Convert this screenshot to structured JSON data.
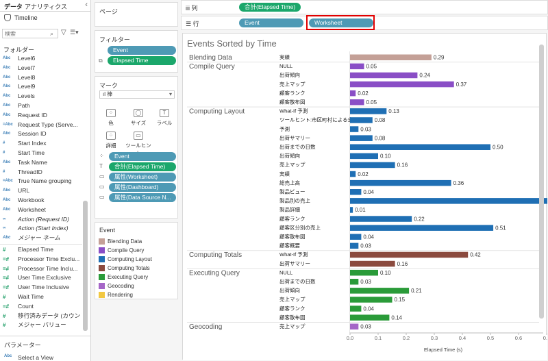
{
  "datapane": {
    "tabs": [
      "データ",
      "アナリティクス"
    ],
    "source": "Timeline",
    "search_placeholder": "検索",
    "folders_title": "フォルダー",
    "fields": [
      {
        "type": "Abc",
        "name": "Level6"
      },
      {
        "type": "Abc",
        "name": "Level7"
      },
      {
        "type": "Abc",
        "name": "Level8"
      },
      {
        "type": "Abc",
        "name": "Level9"
      },
      {
        "type": "Abc",
        "name": "Levels"
      },
      {
        "type": "Abc",
        "name": "Path"
      },
      {
        "type": "Abc",
        "name": "Request ID"
      },
      {
        "type": "=Abc",
        "name": "Request Type (Serve..."
      },
      {
        "type": "Abc",
        "name": "Session ID"
      },
      {
        "type": "#",
        "name": "Start Index"
      },
      {
        "type": "#",
        "name": "Start Time"
      },
      {
        "type": "Abc",
        "name": "Task Name"
      },
      {
        "type": "#",
        "name": "ThreadID"
      },
      {
        "type": "=Abc",
        "name": "True Name grouping"
      },
      {
        "type": "Abc",
        "name": "URL"
      },
      {
        "type": "Abc",
        "name": "Workbook"
      },
      {
        "type": "Abc",
        "name": "Worksheet"
      },
      {
        "type": "∞",
        "name": "Action (Request ID)",
        "italic": true
      },
      {
        "type": "∞",
        "name": "Action (Start Index)",
        "italic": true
      },
      {
        "type": "Abc",
        "name": "メジャー ネーム",
        "italic": true
      }
    ],
    "measures": [
      {
        "type": "#",
        "name": "Elapsed Time"
      },
      {
        "type": "=#",
        "name": "Processor Time Exclu..."
      },
      {
        "type": "=#",
        "name": "Processor Time Inclu..."
      },
      {
        "type": "=#",
        "name": "User Time Exclusive"
      },
      {
        "type": "=#",
        "name": "User Time Inclusive"
      },
      {
        "type": "#",
        "name": "Wait Time"
      },
      {
        "type": "=#",
        "name": "Count"
      },
      {
        "type": "#",
        "name": "移行済みデータ (カウント)"
      },
      {
        "type": "#",
        "name": "メジャー バリュー"
      }
    ],
    "parameters_title": "パラメーター",
    "parameters": [
      {
        "type": "Abc",
        "name": "Select a View"
      }
    ]
  },
  "cards": {
    "pages_title": "ページ",
    "filters_title": "フィルター",
    "filters": [
      "Event",
      "Elapsed Time"
    ],
    "marks_title": "マーク",
    "mark_type": "棒",
    "mark_buttons": [
      "色",
      "サイズ",
      "ラベル",
      "詳細",
      "ツールヒント"
    ],
    "mark_fields": [
      "Event",
      "合計(Elapsed Time)",
      "属性(Worksheet)",
      "属性(Dashboard)",
      "属性(Data Source N..."
    ],
    "legend_title": "Event",
    "legend": [
      {
        "label": "Blending Data",
        "color": "#c4a097"
      },
      {
        "label": "Compile Query",
        "color": "#8a4ec6"
      },
      {
        "label": "Computing Layout",
        "color": "#1f6fb4"
      },
      {
        "label": "Computing Totals",
        "color": "#8b4a3e"
      },
      {
        "label": "Executing Query",
        "color": "#2a9b39"
      },
      {
        "label": "Geocoding",
        "color": "#a566c7"
      },
      {
        "label": "Rendering",
        "color": "#f2c842"
      }
    ]
  },
  "shelves": {
    "columns_label": "列",
    "columns_pills": [
      "合計(Elapsed Time)"
    ],
    "rows_label": "行",
    "rows_pills": [
      "Event",
      "Worksheet"
    ]
  },
  "view": {
    "title": "Events Sorted by Time",
    "x_axis_title": "Elapsed Time (s)"
  },
  "chart_data": {
    "type": "bar",
    "title": "Events Sorted by Time",
    "xlabel": "Elapsed Time (s)",
    "xlim": [
      0,
      0.8
    ],
    "xticks": [
      "0.0",
      "0.1",
      "0.2",
      "0.3",
      "0.4",
      "0.5",
      "0.6",
      "0.7",
      "0.8"
    ],
    "groups": [
      {
        "name": "Blending Data",
        "color": "#c4a097",
        "rows": [
          {
            "label": "実績",
            "value": 0.29
          }
        ]
      },
      {
        "name": "Compile Query",
        "color": "#8a4ec6",
        "rows": [
          {
            "label": "NULL",
            "value": 0.05
          },
          {
            "label": "出荷傾向",
            "value": 0.24
          },
          {
            "label": "売上マップ",
            "value": 0.37
          },
          {
            "label": "顧客ランク",
            "value": 0.02
          },
          {
            "label": "顧客散布図",
            "value": 0.05
          }
        ]
      },
      {
        "name": "Computing Layout",
        "color": "#1f6fb4",
        "rows": [
          {
            "label": "What-If 予測",
            "value": 0.13
          },
          {
            "label": "ツールヒント:市区町村による全...",
            "value": 0.08
          },
          {
            "label": "予測",
            "value": 0.03
          },
          {
            "label": "出荷サマリー",
            "value": 0.08
          },
          {
            "label": "出荷までの日数",
            "value": 0.5
          },
          {
            "label": "出荷傾向",
            "value": 0.1
          },
          {
            "label": "売上マップ",
            "value": 0.16
          },
          {
            "label": "実績",
            "value": 0.02
          },
          {
            "label": "総売上高",
            "value": 0.36
          },
          {
            "label": "製品ビュー",
            "value": 0.04
          },
          {
            "label": "製品別の売上",
            "value": 0.71
          },
          {
            "label": "製品詳細",
            "value": 0.01
          },
          {
            "label": "顧客ランク",
            "value": 0.22
          },
          {
            "label": "顧客区分別の売上",
            "value": 0.51
          },
          {
            "label": "顧客散布図",
            "value": 0.04
          },
          {
            "label": "顧客概要",
            "value": 0.03
          }
        ]
      },
      {
        "name": "Computing Totals",
        "color": "#8b4a3e",
        "rows": [
          {
            "label": "What-If 予測",
            "value": 0.42
          },
          {
            "label": "出荷サマリー",
            "value": 0.16
          }
        ]
      },
      {
        "name": "Executing Query",
        "color": "#2a9b39",
        "rows": [
          {
            "label": "NULL",
            "value": 0.1
          },
          {
            "label": "出荷までの日数",
            "value": 0.03
          },
          {
            "label": "出荷傾向",
            "value": 0.21
          },
          {
            "label": "売上マップ",
            "value": 0.15
          },
          {
            "label": "顧客ランク",
            "value": 0.04
          },
          {
            "label": "顧客散布図",
            "value": 0.14
          }
        ]
      },
      {
        "name": "Geocoding",
        "color": "#a566c7",
        "rows": [
          {
            "label": "売上マップ",
            "value": 0.03
          }
        ]
      }
    ]
  }
}
